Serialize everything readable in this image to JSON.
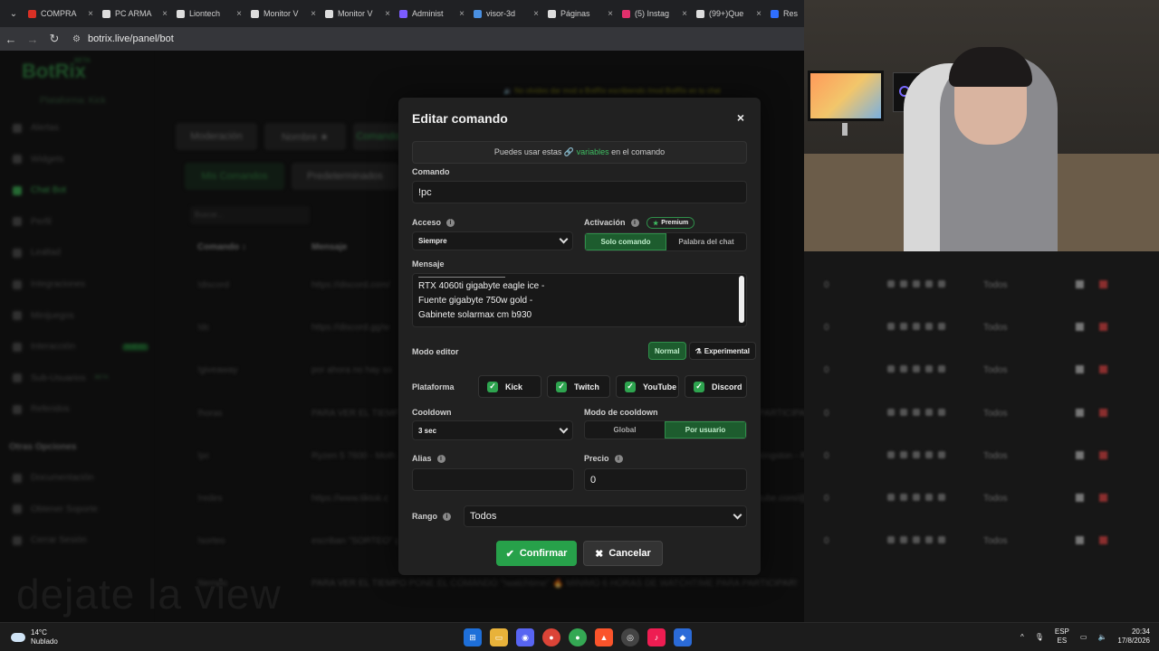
{
  "browser": {
    "tabs": [
      {
        "label": "COMPRA",
        "color": "#d93025"
      },
      {
        "label": "PC ARMA",
        "color": "#ddd"
      },
      {
        "label": "Liontech",
        "color": "#ddd"
      },
      {
        "label": "Monitor V",
        "color": "#ddd"
      },
      {
        "label": "Monitor V",
        "color": "#ddd"
      },
      {
        "label": "Administ",
        "color": "#7b5cff"
      },
      {
        "label": "visor-3d",
        "color": "#4a90e2"
      },
      {
        "label": "Páginas",
        "color": "#ddd"
      },
      {
        "label": "(5) Instag",
        "color": "#e1306c"
      },
      {
        "label": "(99+)Que",
        "color": "#ddd"
      },
      {
        "label": "Res",
        "color": "#2f6fff"
      }
    ],
    "url": "botrix.live/panel/bot",
    "close_glyph": "×"
  },
  "sidebar": {
    "logo": "BotRix",
    "logo_badge": "BETA",
    "platform": "Plataforma: Kick",
    "items": [
      {
        "label": "Alertas"
      },
      {
        "label": "Widgets"
      },
      {
        "label": "Chat Bot"
      },
      {
        "label": "Perfil"
      },
      {
        "label": "Lealtad"
      },
      {
        "label": "Integraciones"
      },
      {
        "label": "Minijuegos"
      },
      {
        "label": "Interacción",
        "badge": "NUEVO"
      },
      {
        "label": "Sub-Usuarios",
        "badge": "BETA"
      },
      {
        "label": "Referidos"
      }
    ],
    "section": "Otras Opciones",
    "other_items": [
      {
        "label": "Documentación"
      },
      {
        "label": "Obtener Soporte"
      },
      {
        "label": "Cerrar Sesión"
      }
    ]
  },
  "main": {
    "notice": "🔉 No olvides dar mod a BotRix escribiendo   /mod BotRix   en tu chat",
    "tabs": [
      "Moderación",
      "Nombre ★",
      "Comandos"
    ],
    "subtabs": [
      "Mis Comandos",
      "Predeterminados"
    ],
    "search_placeholder": "Buscar...",
    "headers": [
      "Comando ↕",
      "Mensaje"
    ],
    "rows": [
      {
        "cmd": "!discord",
        "msg": "https://discord.com/",
        "count": "0",
        "rank": "Todos"
      },
      {
        "cmd": "!dc",
        "msg": "https://discord.gg/w",
        "count": "0",
        "rank": "Todos"
      },
      {
        "cmd": "!giveaway",
        "msg": "por ahora no hay so",
        "count": "0",
        "rank": "Todos"
      },
      {
        "cmd": "!horas",
        "msg": "PARA VER EL TIEMPO",
        "extra": "PARTICIPAR!",
        "count": "0",
        "rank": "Todos"
      },
      {
        "cmd": "!pc",
        "msg": "Ryzen 5 7600 - Moth",
        "extra": "kingston - R1",
        "count": "0",
        "rank": "Todos"
      },
      {
        "cmd": "!redes",
        "msg": "https://www.tiktok.c",
        "extra": "tube.com/@",
        "count": "0",
        "rank": "Todos"
      },
      {
        "cmd": "!sorteo",
        "msg": "escriban \"SORTEO\" p",
        "count": "0",
        "rank": "Todos"
      },
      {
        "cmd": "!tiempo",
        "msg": "PARA VER EL TIEMPO PONE EL COMANDO \"!watchtime\" 🔥 MINIMO 6 HORAS DE WATCHTIME PARA PARTICIPAR!",
        "count": "0",
        "rank": "Todos"
      }
    ]
  },
  "modal": {
    "title": "Editar comando",
    "close": "×",
    "info_pre": "Puedes usar estas ",
    "info_link": "🔗 variables",
    "info_post": " en el comando",
    "command_label": "Comando",
    "command_value": "!pc",
    "access_label": "Acceso",
    "access_value": "Siempre",
    "activation_label": "Activación",
    "premium": "Premium",
    "activation_options": [
      "Solo comando",
      "Palabra del chat"
    ],
    "message_label": "Mensaje",
    "message_lines": [
      "RTX 4060ti gigabyte eagle ice -",
      "Fuente gigabyte 750w gold -",
      "Gabinete solarmax cm b930"
    ],
    "editor_label": "Modo editor",
    "editor_options": [
      "Normal",
      "Experimental"
    ],
    "platform_label": "Plataforma",
    "platforms": [
      "Kick",
      "Twitch",
      "YouTube",
      "Discord"
    ],
    "cooldown_label": "Cooldown",
    "cooldown_value": "3 sec",
    "cooldown_mode_label": "Modo de cooldown",
    "cooldown_modes": [
      "Global",
      "Por usuario"
    ],
    "alias_label": "Alias",
    "alias_value": "",
    "price_label": "Precio",
    "price_value": "0",
    "rank_label": "Rango",
    "rank_value": "Todos",
    "confirm": "Confirmar",
    "cancel": "Cancelar"
  },
  "stream_overlay": {
    "watermark": "dejate la view"
  },
  "taskbar": {
    "temp": "14°C",
    "weather": "Nublado",
    "lang": "ESP",
    "lang_region": "ES",
    "time": "20:34",
    "date": "17/8/2026"
  },
  "colors": {
    "accent": "#27a14a",
    "accent_dark": "#1d5c2e",
    "modal_bg": "#212121",
    "danger": "#8a2e2e"
  }
}
